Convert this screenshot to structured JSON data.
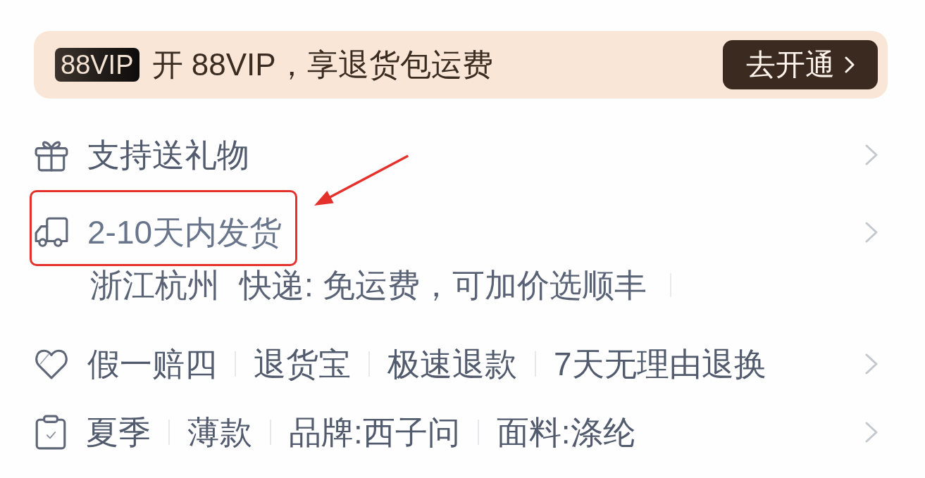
{
  "promo_banner": {
    "badge": "88VIP",
    "text": "开 88VIP，享退货包运费",
    "button": {
      "label": "去开通"
    }
  },
  "rows": [
    {
      "kind": "gift",
      "title": "支持送礼物",
      "highlighted": false
    },
    {
      "kind": "shipping",
      "title": "2-10天内发货",
      "highlighted": true,
      "details": [
        "浙江杭州",
        "快递: 免运费，可加价选顺丰"
      ]
    },
    {
      "kind": "guarantee",
      "tags": [
        "假一赔四",
        "退货宝",
        "极速退款",
        "7天无理由退换"
      ],
      "highlighted": false
    },
    {
      "kind": "specs",
      "tags": [
        "夏季",
        "薄款",
        "品牌:西子问",
        "面料:涤纶"
      ],
      "highlighted": false
    }
  ]
}
